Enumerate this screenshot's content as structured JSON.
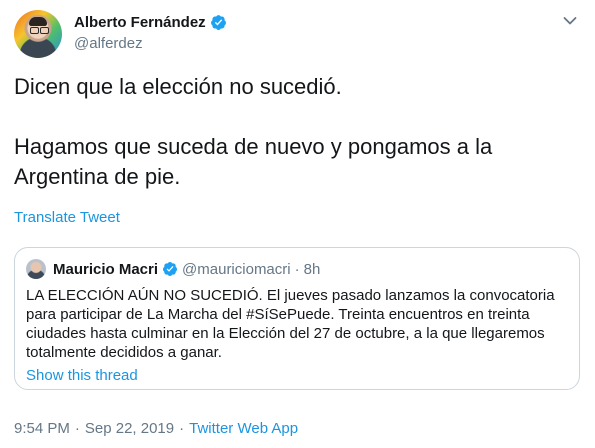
{
  "author": {
    "display_name": "Alberto Fernández",
    "handle": "@alferdez",
    "avatar_icon": "user-avatar",
    "verified_icon": "verified-badge-icon"
  },
  "tweet": {
    "paragraphs": [
      "Dicen que la elección no sucedió.",
      "Hagamos que suceda de nuevo y pongamos a la Argentina de pie."
    ],
    "translate_label": "Translate Tweet"
  },
  "quoted_tweet": {
    "display_name": "Mauricio Macri",
    "handle": "@mauriciomacri",
    "separator": "·",
    "time_ago": "8h",
    "text": "LA ELECCIÓN AÚN NO SUCEDIÓ. El jueves pasado lanzamos la convocatoria para participar de La Marcha del #SíSePuede. Treinta encuentros en treinta ciudades hasta culminar en la Elección del 27 de octubre, a la que llegaremos totalmente decididos a ganar.",
    "show_thread_label": "Show this thread"
  },
  "meta": {
    "time": "9:54 PM",
    "date": "Sep 22, 2019",
    "separator": "·",
    "source": "Twitter Web App"
  },
  "colors": {
    "accent": "#1b95e0",
    "text": "#14171a",
    "muted": "#657786",
    "border": "#ccd6dd",
    "verified": "#1da1f2"
  }
}
